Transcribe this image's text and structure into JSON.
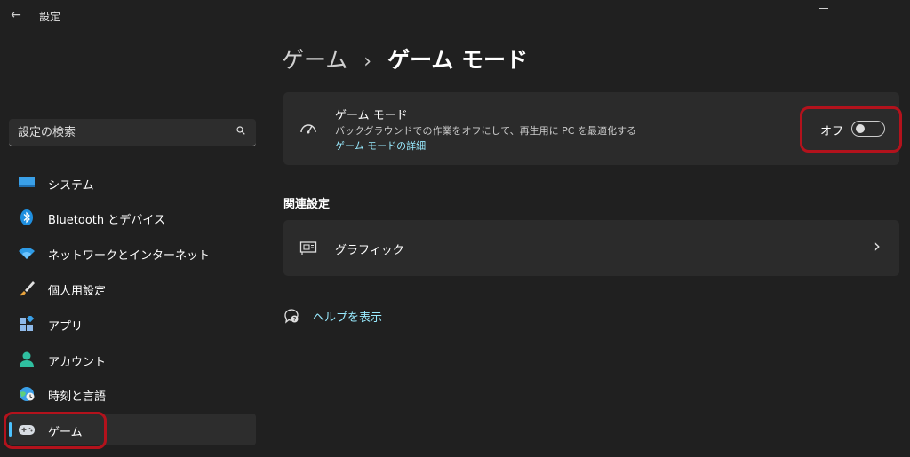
{
  "window": {
    "title": "設定",
    "back_glyph": "←"
  },
  "sidebar": {
    "search_placeholder": "設定の検索",
    "items": [
      {
        "label": "システム",
        "icon": "system-display-icon"
      },
      {
        "label": "Bluetooth とデバイス",
        "icon": "bluetooth-icon"
      },
      {
        "label": "ネットワークとインターネット",
        "icon": "wifi-icon"
      },
      {
        "label": "個人用設定",
        "icon": "paintbrush-icon"
      },
      {
        "label": "アプリ",
        "icon": "apps-icon"
      },
      {
        "label": "アカウント",
        "icon": "account-icon"
      },
      {
        "label": "時刻と言語",
        "icon": "globe-clock-icon"
      },
      {
        "label": "ゲーム",
        "icon": "gamepad-icon",
        "selected": true
      }
    ]
  },
  "breadcrumb": {
    "parent": "ゲーム",
    "separator": "›",
    "current": "ゲーム モード"
  },
  "game_mode_card": {
    "title": "ゲーム モード",
    "description": "バックグラウンドでの作業をオフにして、再生用に PC を最適化する",
    "link": "ゲーム モードの詳細",
    "toggle_state": "オフ",
    "toggle_on": false
  },
  "related": {
    "section_title": "関連設定",
    "graphics_label": "グラフィック",
    "chevron": "›"
  },
  "help": {
    "label": "ヘルプを表示"
  },
  "colors": {
    "background": "#202020",
    "card": "#2b2b2b",
    "accent": "#4cc2ff",
    "link": "#99ebff",
    "highlight": "#b3121c"
  }
}
